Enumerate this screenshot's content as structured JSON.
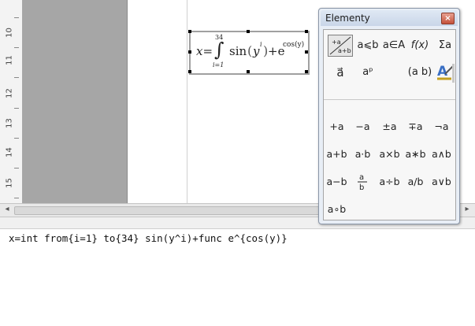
{
  "ruler": {
    "numbers": [
      "10",
      "11",
      "12",
      "13",
      "14",
      "15"
    ]
  },
  "formula": {
    "lhs": "x=",
    "integral_sign": "∫",
    "upper": "34",
    "lower": "i=1",
    "sin": "sin",
    "open_paren": "(",
    "base": "y",
    "exponent": "i",
    "close_paren": ")",
    "plus_e": "+e",
    "e_exponent": "cos(y)"
  },
  "panel": {
    "title": "Elementy",
    "close_symbol": "×",
    "categories": [
      {
        "label": "+a a+b",
        "selected": true
      },
      {
        "label": "a⩽b"
      },
      {
        "label": "a∈A"
      },
      {
        "label": "f(x)"
      },
      {
        "label": "Σa"
      },
      {
        "label": "a⃗"
      },
      {
        "label": "aᵖ"
      },
      {
        "label": "(a b)"
      },
      {
        "label": "A"
      }
    ],
    "operators": [
      [
        "+a",
        "−a",
        "±a",
        "∓a",
        "¬a"
      ],
      [
        "a+b",
        "a⋅b",
        "a×b",
        "a∗b",
        "a∧b"
      ],
      [
        "a−b",
        "a/b",
        "a÷b",
        "a/b",
        "a∨b"
      ],
      [
        "a∘b"
      ]
    ]
  },
  "command": {
    "text": "x=int from{i=1} to{34} sin(y^i)+func e^{cos(y)}"
  }
}
